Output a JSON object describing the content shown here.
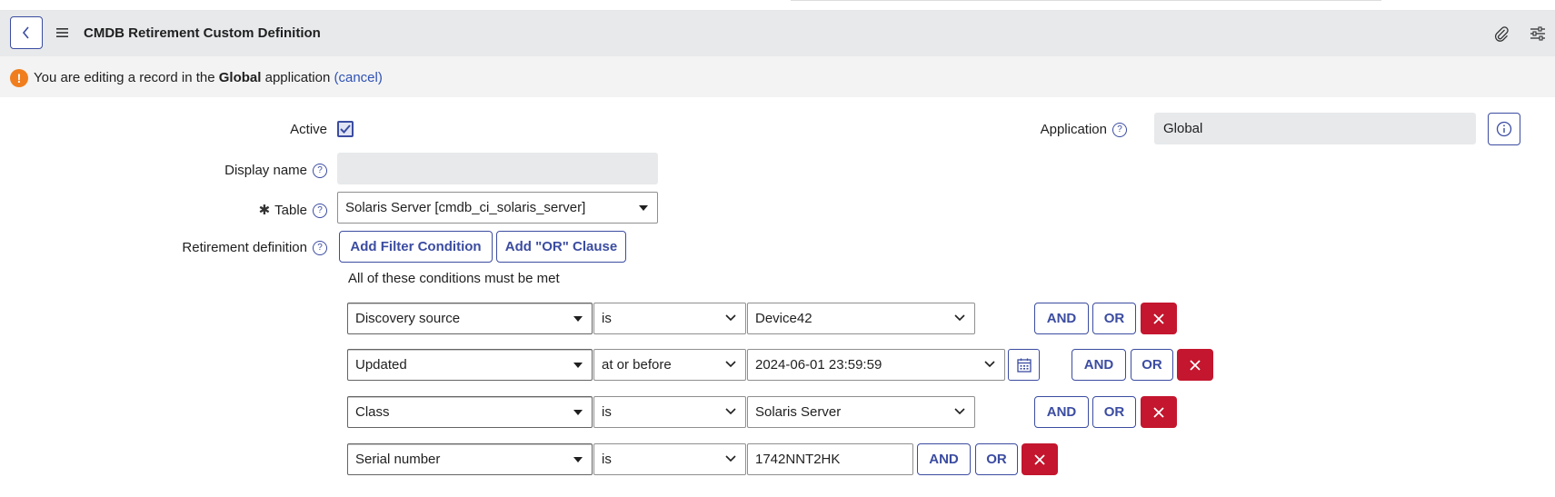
{
  "header": {
    "title": "CMDB Retirement Custom Definition",
    "back_icon": "chevron-left-icon",
    "menu_icon": "hamburger-icon",
    "attach_icon": "paperclip-icon",
    "settings_icon": "sliders-icon"
  },
  "notice": {
    "prefix": "You are editing a record in the ",
    "app": "Global",
    "suffix": " application ",
    "cancel": "(cancel)"
  },
  "form": {
    "active_label": "Active",
    "active_checked": true,
    "display_name_label": "Display name",
    "display_name_value": "",
    "table_label": "Table",
    "table_required_mark": "✱",
    "table_value": "Solaris Server [cmdb_ci_solaris_server]",
    "retirement_label": "Retirement definition",
    "application_label": "Application",
    "application_value": "Global",
    "help_glyph": "?"
  },
  "filter": {
    "add_condition": "Add Filter Condition",
    "add_or": "Add \"OR\" Clause",
    "all_met": "All of these conditions must be met",
    "and_label": "AND",
    "or_label": "OR",
    "conditions": [
      {
        "field": "Discovery source",
        "operator": "is",
        "value": "Device42"
      },
      {
        "field": "Updated",
        "operator": "at or before",
        "value": "2024-06-01 23:59:59"
      },
      {
        "field": "Class",
        "operator": "is",
        "value": "Solaris Server"
      },
      {
        "field": "Serial number",
        "operator": "is",
        "value": "1742NNT2HK"
      }
    ]
  },
  "colors": {
    "accent": "#3b4ca1",
    "delete": "#c4162e",
    "warning": "#f07e1e",
    "link": "#2f52b4"
  }
}
